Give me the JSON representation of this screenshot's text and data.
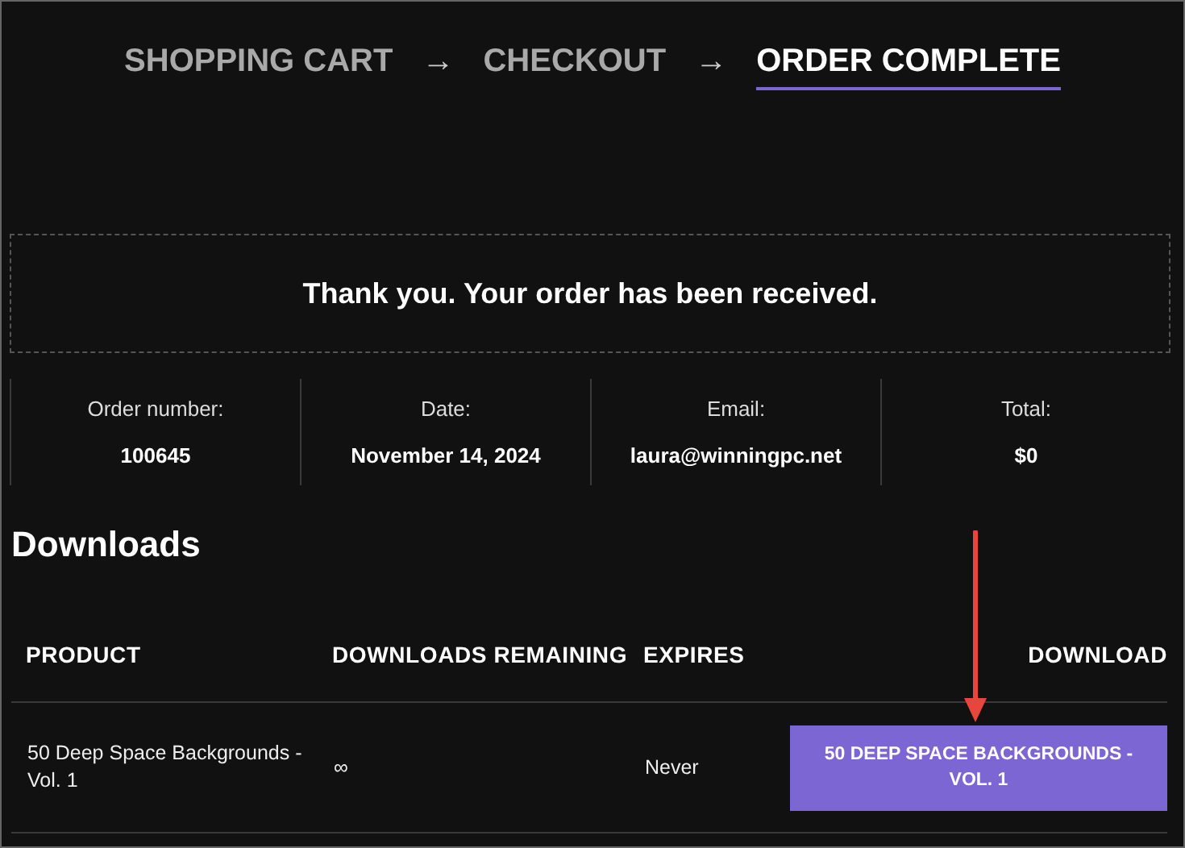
{
  "checkout_steps": [
    {
      "kind": "step",
      "label": "SHOPPING CART",
      "selected": false
    },
    {
      "kind": "arrow",
      "label": "→"
    },
    {
      "kind": "step",
      "label": "CHECKOUT",
      "selected": false
    },
    {
      "kind": "arrow",
      "label": "→"
    },
    {
      "kind": "step",
      "label": "ORDER COMPLETE",
      "selected": true
    }
  ],
  "notice": "Thank you. Your order has been received.",
  "order_overview": [
    {
      "label": "Order number:",
      "value": "100645"
    },
    {
      "label": "Date:",
      "value": "November 14, 2024"
    },
    {
      "label": "Email:",
      "value": "laura@winningpc.net"
    },
    {
      "label": "Total:",
      "value": "$0"
    }
  ],
  "downloads": {
    "title": "Downloads",
    "columns": [
      "PRODUCT",
      "DOWNLOADS REMAINING",
      "EXPIRES",
      "DOWNLOAD"
    ],
    "rows": [
      {
        "product": "50 Deep Space Backgrounds - Vol. 1",
        "remaining": "∞",
        "expires": "Never",
        "download": "50 DEEP SPACE BACKGROUNDS - VOL. 1"
      }
    ]
  },
  "annotation": {
    "kind": "arrow"
  }
}
